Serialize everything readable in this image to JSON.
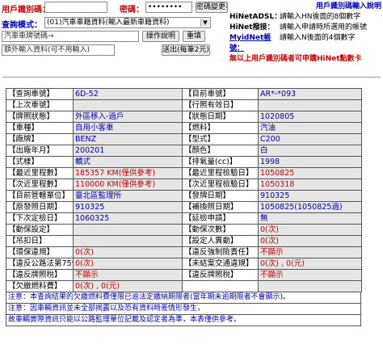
{
  "top": {
    "user_id_label": "用戶識別碼：",
    "user_id_value": "",
    "password_label": "密碼：",
    "password_value": "••••••••",
    "change_password_button": "密碼變更表：",
    "query_mode_label": "查詢模式：",
    "query_mode_value": "(01)汽車車籍資料(輸入最新車籍資料)",
    "plate_placeholder": "汽車車牌號碼→",
    "plate_value": "",
    "operation_help_button": "操作說明",
    "reset_button": "重填",
    "extra_input_placeholder": "額外輸入資料(可不用輸入)",
    "submit_button": "送出(每筆2元)"
  },
  "hint": {
    "title": "用戶識別碼輸入說明",
    "rows": [
      {
        "key": "HiNetADSL：",
        "value": "請輸入HN後面的8個數字"
      },
      {
        "key": "HiNet撥接：",
        "value": "請輸入申請時所選用的帳號"
      },
      {
        "key": "MyidNet帳號：",
        "value": "請輸入N後面的4個數字"
      }
    ],
    "footer": "無以上用戶識別碼者可申購HiNet點數卡"
  },
  "vehicle": {
    "rows": [
      {
        "k1": "【查詢車號】",
        "v1": "6D-52",
        "c1": "blue",
        "k2": "【目前車號】",
        "v2": "AR*-*093",
        "c2": "blue"
      },
      {
        "k1": "【上次車號】",
        "v1": "",
        "c1": "",
        "k2": "【行照有效日】",
        "v2": "",
        "c2": ""
      },
      {
        "k1": "【牌照狀態】",
        "v1": "外區移入-過戶",
        "c1": "blue",
        "k2": "【狀態日期】",
        "v2": "1020805",
        "c2": "blue"
      },
      {
        "k1": "【車種】",
        "v1": "自用小客車",
        "c1": "blue",
        "k2": "【燃料】",
        "v2": "汽油",
        "c2": "blue"
      },
      {
        "k1": "【廠牌】",
        "v1": "BENZ",
        "c1": "blue",
        "k2": "【型式】",
        "v2": "C200",
        "c2": "blue"
      },
      {
        "k1": "【出廠年月】",
        "v1": "200201",
        "c1": "blue",
        "k2": "【顏色】",
        "v2": "白",
        "c2": "blue"
      },
      {
        "k1": "【式樣】",
        "v1": "轎式",
        "c1": "blue",
        "k2": "【排氣量(cc)】",
        "v2": "1998",
        "c2": "blue"
      },
      {
        "k1": "【最近里程數】",
        "v1": "185357 KM(僅供參考)",
        "c1": "red",
        "k2": "【最近里程檢驗日】",
        "v2": "1050825",
        "c2": "red"
      },
      {
        "k1": "【次近里程數】",
        "v1": "110000 KM(僅供參考)",
        "c1": "red",
        "k2": "【次近里程檢驗日】",
        "v2": "1050318",
        "c2": "red"
      },
      {
        "k1": "【目前管轄單位】",
        "v1": "臺北區監理所",
        "c1": "blue",
        "k2": "【發牌日期】",
        "v2": "910325",
        "c2": "blue"
      },
      {
        "k1": "【原發照日期】",
        "v1": "910325",
        "c1": "blue",
        "k2": "【補換照日期】",
        "v2": "1050825(1050825過)",
        "c2": "blue"
      },
      {
        "k1": "【下次定檢日】",
        "v1": "1060325",
        "c1": "blue",
        "k2": "【延檢申請】",
        "v2": "無",
        "c2": "blue"
      },
      {
        "k1": "【動保設定】",
        "v1": "",
        "c1": "",
        "k2": "【動保次數】",
        "v2": "0(次)",
        "c2": "red"
      },
      {
        "k1": "【吊扣日】",
        "v1": "",
        "c1": "",
        "k2": "【設定人異動】",
        "v2": "0(次)",
        "c2": "red"
      },
      {
        "k1": "【環保違規】",
        "v1": "0(次)",
        "c1": "red",
        "k2": "【違反強制險責任】",
        "v2": "不顯示",
        "c2": "red"
      },
      {
        "k1": "【違反公路法第75條】",
        "v1": "0(次)",
        "c1": "red",
        "k2": "【未結案交通違規】",
        "v2": "0(次) , 0(元)",
        "c2": "red"
      },
      {
        "k1": "【違反牌照稅】",
        "v1": "不顯示",
        "c1": "red",
        "k2": "【違反牌照稅】",
        "v2": "不顯示",
        "c2": "red"
      },
      {
        "k1": "【欠繳燃料費】",
        "v1": "0(次) , 0(元)",
        "c1": "red",
        "k2": "",
        "v2": "",
        "c2": ""
      }
    ],
    "notes": [
      "注意：本查詢結果的欠繳燃料費僅限已逾法定繳納期限者(當年期未逾期限者不會顯示)。",
      "注意：因車輛資訊並未全部揭露以及恐有資料時差情形發生，",
      "故車輛實際資訊只能以公路監理單位記載及認定者為準，本表僅供參考。"
    ]
  },
  "colors": {
    "red": "#d00000",
    "blue": "#0000c0",
    "value_bg": "#e6e6e6"
  }
}
